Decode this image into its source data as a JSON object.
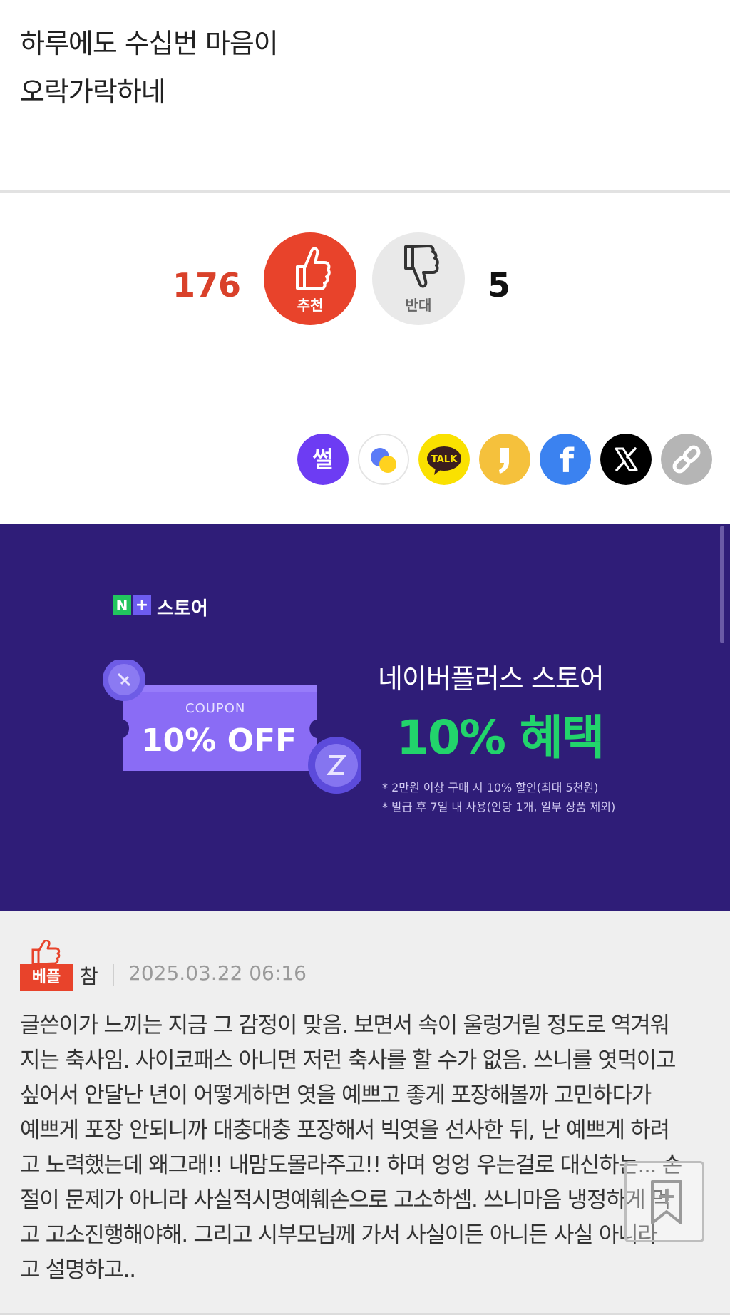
{
  "article": {
    "lines": [
      "하루에도 수십번 마음이",
      "오락가락하네"
    ]
  },
  "votes": {
    "up_count": "176",
    "up_label": "추천",
    "down_label": "반대",
    "down_count": "5",
    "up_color": "#e8432b",
    "down_color": "#e9e9e9"
  },
  "share": {
    "items": [
      {
        "name": "ssul",
        "text": "썰",
        "color": "#6d3cf3"
      },
      {
        "name": "chat-bubbles",
        "color": "#ffffff"
      },
      {
        "name": "kakaotalk",
        "text": "TALK",
        "color": "#fae100"
      },
      {
        "name": "kakaostory",
        "color": "#f5c13c"
      },
      {
        "name": "facebook",
        "text": "f",
        "color": "#3b82f0"
      },
      {
        "name": "x",
        "color": "#000000"
      },
      {
        "name": "copy-link",
        "color": "#b5b5b5"
      }
    ]
  },
  "ad": {
    "logo_n": "N",
    "logo_plus": "+",
    "logo_text": "스토어",
    "coupon_small": "COUPON",
    "coupon_big": "10% OFF",
    "headline": "네이버플러스 스토어",
    "benefit": "10% 혜택",
    "note1": "* 2만원 이상 구매 시 10% 할인(최대 5천원)",
    "note2": "* 발급 후 7일 내 사용(인당 1개, 일부 상품 제외)",
    "bg_color": "#2f1d78",
    "benefit_color": "#22d46b"
  },
  "comment": {
    "badge": "베플",
    "author": "참",
    "date": "2025.03.22 06:16",
    "lines": [
      "글쓴이가 느끼는 지금 그 감정이 맞음. 보면서 속이 울렁거릴 정도로 역겨워",
      "지는 축사임. 사이코패스 아니면 저런 축사를 할 수가 없음. 쓰니를 엿먹이고",
      "싶어서 안달난 년이 어떻게하면 엿을 예쁘고 좋게 포장해볼까 고민하다가",
      "예쁘게 포장 안되니까 대충대충 포장해서 빅엿을 선사한 뒤, 난 예쁘게 하려",
      "고 노력했는데 왜그래!! 내맘도몰라주고!! 하며 엉엉 우는걸로 대신하는... 손",
      "절이 문제가 아니라 사실적시명예훼손으로 고소하셈. 쓰니마음 냉정하게 먹",
      "고 고소진행해야해. 그리고 시부모님께 가서 사실이든 아니든 사실 아니라",
      "고 설명하고.."
    ]
  }
}
